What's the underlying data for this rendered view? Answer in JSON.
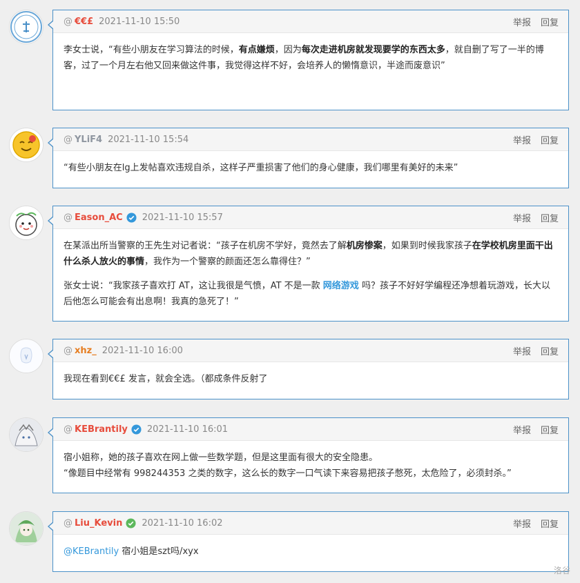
{
  "actions": {
    "report": "举报",
    "reply": "回复"
  },
  "watermark": "洛谷",
  "comments": [
    {
      "user": "€€£",
      "time": "2021-11-10 15:50",
      "body": [
        [
          "李女士说，“有些小朋友在学习算法的时候，",
          "有点嫌烦",
          "，因为",
          "每次走进机房就发现要学的东西太多",
          "，就自删了写了一半的博客，过了一个月左右他又回来做这件事，我觉得这样不好，会培养人的懒惰意识，半途而废意识”"
        ]
      ]
    },
    {
      "user": "YLiF4",
      "time": "2021-11-10 15:54",
      "body": "“有些小朋友在lg上发帖喜欢违规自杀，这样子严重损害了他们的身心健康，我们哪里有美好的未来”"
    },
    {
      "user": "Eason_AC",
      "time": "2021-11-10 15:57",
      "p1": [
        "在某派出所当警察的王先生对记者说：“孩子在机房不学好，竟然去了解",
        "机房惨案",
        "，如果到时候我家孩子",
        "在学校机房里面干出什么杀人放火的事情",
        "，我作为一个警察的颜面还怎么靠得住？”"
      ],
      "p2": [
        "张女士说：“我家孩子喜欢打 AT，这让我很是气愤，AT 不是一款 ",
        "网络游戏",
        " 吗？孩子不好好学编程还净想着玩游戏，长大以后他怎么可能会有出息啊！我真的急死了！”"
      ]
    },
    {
      "user": "xhz_",
      "time": "2021-11-10 16:00",
      "body": "我现在看到€€£ 发言，就会全选。（都成条件反射了"
    },
    {
      "user": "KEBrantily",
      "time": "2021-11-10 16:01",
      "line1": "宿小姐称，她的孩子喜欢在网上做一些数学题，但是这里面有很大的安全隐患。",
      "line2": "“像题目中经常有 998244353 之类的数字，这么长的数字一口气读下来容易把孩子憋死，太危险了，必须封杀。”"
    },
    {
      "user": "Liu_Kevin",
      "time": "2021-11-10 16:02",
      "mention": "@KEBrantily",
      "rest": " 宿小姐是szt吗/xyx"
    }
  ],
  "colors": {
    "red": "#e74c3c",
    "orange": "#e67e22",
    "gray": "#8f96a0",
    "blue": "#3498db",
    "verify_blue": "#3498db",
    "verify_green": "#5cb85c",
    "border": "#4a90c8"
  }
}
